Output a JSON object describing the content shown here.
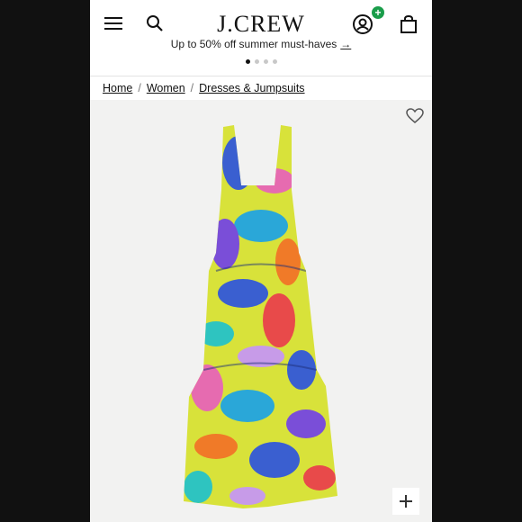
{
  "header": {
    "logo": "J.CREW",
    "account_badge": "+"
  },
  "promo": {
    "text": "Up to 50% off summer must-haves",
    "link": "→",
    "slides": 4,
    "active_slide": 1
  },
  "breadcrumb": {
    "items": [
      "Home",
      "Women",
      "Dresses & Jumpsuits"
    ],
    "separator": "/"
  },
  "icons": {
    "menu": "menu-icon",
    "search": "search-icon",
    "account": "account-icon",
    "bag": "bag-icon",
    "wishlist": "heart-icon",
    "zoom": "plus-icon"
  },
  "colors": {
    "badge": "#1a9d4a",
    "product_bg": "#f2f2f1",
    "dress_base": "#d8e23a"
  }
}
